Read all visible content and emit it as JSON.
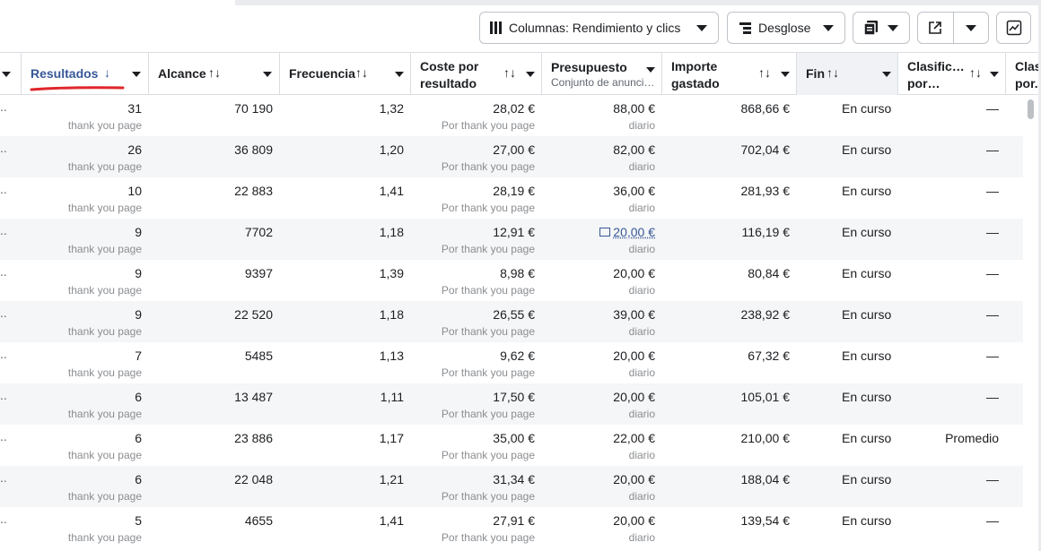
{
  "toolbar": {
    "columns_label": "Columnas: Rendimiento y clics",
    "breakdown_label": "Desglose",
    "icons": {
      "columns": "columns-icon",
      "breakdown": "breakdown-icon",
      "reports": "reports-icon",
      "export": "export-icon",
      "chart": "chart-icon"
    }
  },
  "headers": {
    "results": "Resultados",
    "reach": "Alcance",
    "frequency": "Frecuencia",
    "cost_line1": "Coste por",
    "cost_line2": "resultado",
    "budget": "Presupuesto",
    "budget_sub": "Conjunto de anunci…",
    "spent_line1": "Importe",
    "spent_line2": "gastado",
    "end": "Fin",
    "rank_line1": "Clasific…",
    "rank_line2": "por…",
    "rank2_line1": "Clas",
    "rank2_line2": "por.",
    "sort_desc_glyph": "↓",
    "sort_glyph": "↑↓"
  },
  "colors": {
    "accent_blue": "#385898",
    "sort_underline": "#e0262b",
    "alt_row": "#f5f6f7",
    "border": "#dadde1"
  },
  "rows": [
    {
      "results": "31",
      "results_sub": "thank you page",
      "reach": "70 190",
      "frequency": "1,32",
      "cost": "28,02 €",
      "cost_sub": "Por thank you page",
      "budget": "88,00 €",
      "budget_sub": "diario",
      "spent": "868,66 €",
      "end": "En curso",
      "rank": "—"
    },
    {
      "results": "26",
      "results_sub": "thank you page",
      "reach": "36 809",
      "frequency": "1,20",
      "cost": "27,00 €",
      "cost_sub": "Por thank you page",
      "budget": "82,00 €",
      "budget_sub": "diario",
      "spent": "702,04 €",
      "end": "En curso",
      "rank": "—"
    },
    {
      "results": "10",
      "results_sub": "thank you page",
      "reach": "22 883",
      "frequency": "1,41",
      "cost": "28,19 €",
      "cost_sub": "Por thank you page",
      "budget": "36,00 €",
      "budget_sub": "diario",
      "spent": "281,93 €",
      "end": "En curso",
      "rank": "—"
    },
    {
      "results": "9",
      "results_sub": "thank you page",
      "reach": "7702",
      "frequency": "1,18",
      "cost": "12,91 €",
      "cost_sub": "Por thank you page",
      "budget": "20,00 €",
      "budget_sub": "diario",
      "spent": "116,19 €",
      "end": "En curso",
      "rank": "—",
      "budget_link": true
    },
    {
      "results": "9",
      "results_sub": "thank you page",
      "reach": "9397",
      "frequency": "1,39",
      "cost": "8,98 €",
      "cost_sub": "Por thank you page",
      "budget": "20,00 €",
      "budget_sub": "diario",
      "spent": "80,84 €",
      "end": "En curso",
      "rank": "—"
    },
    {
      "results": "9",
      "results_sub": "thank you page",
      "reach": "22 520",
      "frequency": "1,18",
      "cost": "26,55 €",
      "cost_sub": "Por thank you page",
      "budget": "39,00 €",
      "budget_sub": "diario",
      "spent": "238,92 €",
      "end": "En curso",
      "rank": "—"
    },
    {
      "results": "7",
      "results_sub": "thank you page",
      "reach": "5485",
      "frequency": "1,13",
      "cost": "9,62 €",
      "cost_sub": "Por thank you page",
      "budget": "20,00 €",
      "budget_sub": "diario",
      "spent": "67,32 €",
      "end": "En curso",
      "rank": "—"
    },
    {
      "results": "6",
      "results_sub": "thank you page",
      "reach": "13 487",
      "frequency": "1,11",
      "cost": "17,50 €",
      "cost_sub": "Por thank you page",
      "budget": "20,00 €",
      "budget_sub": "diario",
      "spent": "105,01 €",
      "end": "En curso",
      "rank": "—"
    },
    {
      "results": "6",
      "results_sub": "thank you page",
      "reach": "23 886",
      "frequency": "1,17",
      "cost": "35,00 €",
      "cost_sub": "Por thank you page",
      "budget": "22,00 €",
      "budget_sub": "diario",
      "spent": "210,00 €",
      "end": "En curso",
      "rank": "Promedio"
    },
    {
      "results": "6",
      "results_sub": "thank you page",
      "reach": "22 048",
      "frequency": "1,21",
      "cost": "31,34 €",
      "cost_sub": "Por thank you page",
      "budget": "20,00 €",
      "budget_sub": "diario",
      "spent": "188,04 €",
      "end": "En curso",
      "rank": "—"
    },
    {
      "results": "5",
      "results_sub": "thank you page",
      "reach": "4655",
      "frequency": "1,41",
      "cost": "27,91 €",
      "cost_sub": "Por thank you page",
      "budget": "20,00 €",
      "budget_sub": "diario",
      "spent": "139,54 €",
      "end": "En curso",
      "rank": "—"
    }
  ]
}
